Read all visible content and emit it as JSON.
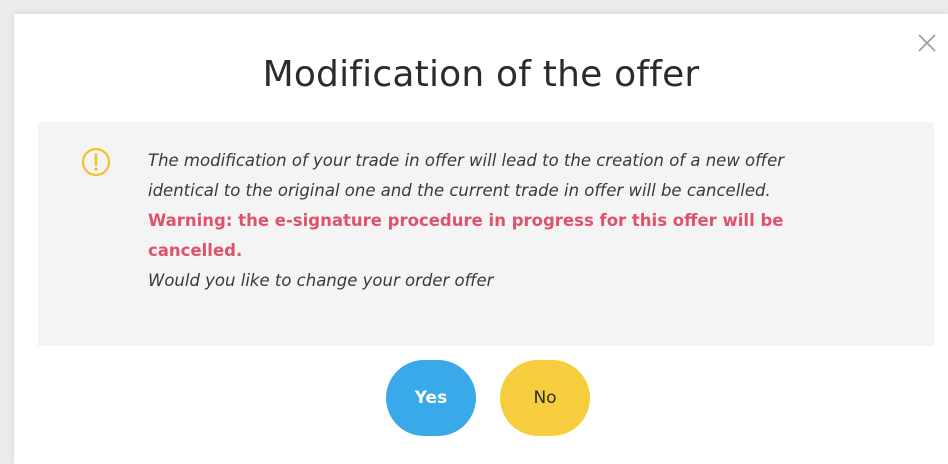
{
  "dialog": {
    "title": "Modification of the offer",
    "close_icon": "close-icon",
    "warning_icon": "exclamation-circle-icon",
    "message_line1": "The modification of your trade in offer will lead to the creation of a new offer",
    "message_line2": "identical to the original one and the current trade in offer will be cancelled.",
    "warning_line1": "Warning: the e-signature procedure in progress for this offer will be",
    "warning_line2": "cancelled.",
    "question": "Would you like to change your order offer",
    "yes_label": "Yes",
    "no_label": "No"
  },
  "colors": {
    "yes_button": "#3aa9ea",
    "no_button": "#f6cd3d",
    "warning_text": "#e0526a",
    "warning_icon": "#f2c12e",
    "panel_background": "#f4f4f4"
  }
}
